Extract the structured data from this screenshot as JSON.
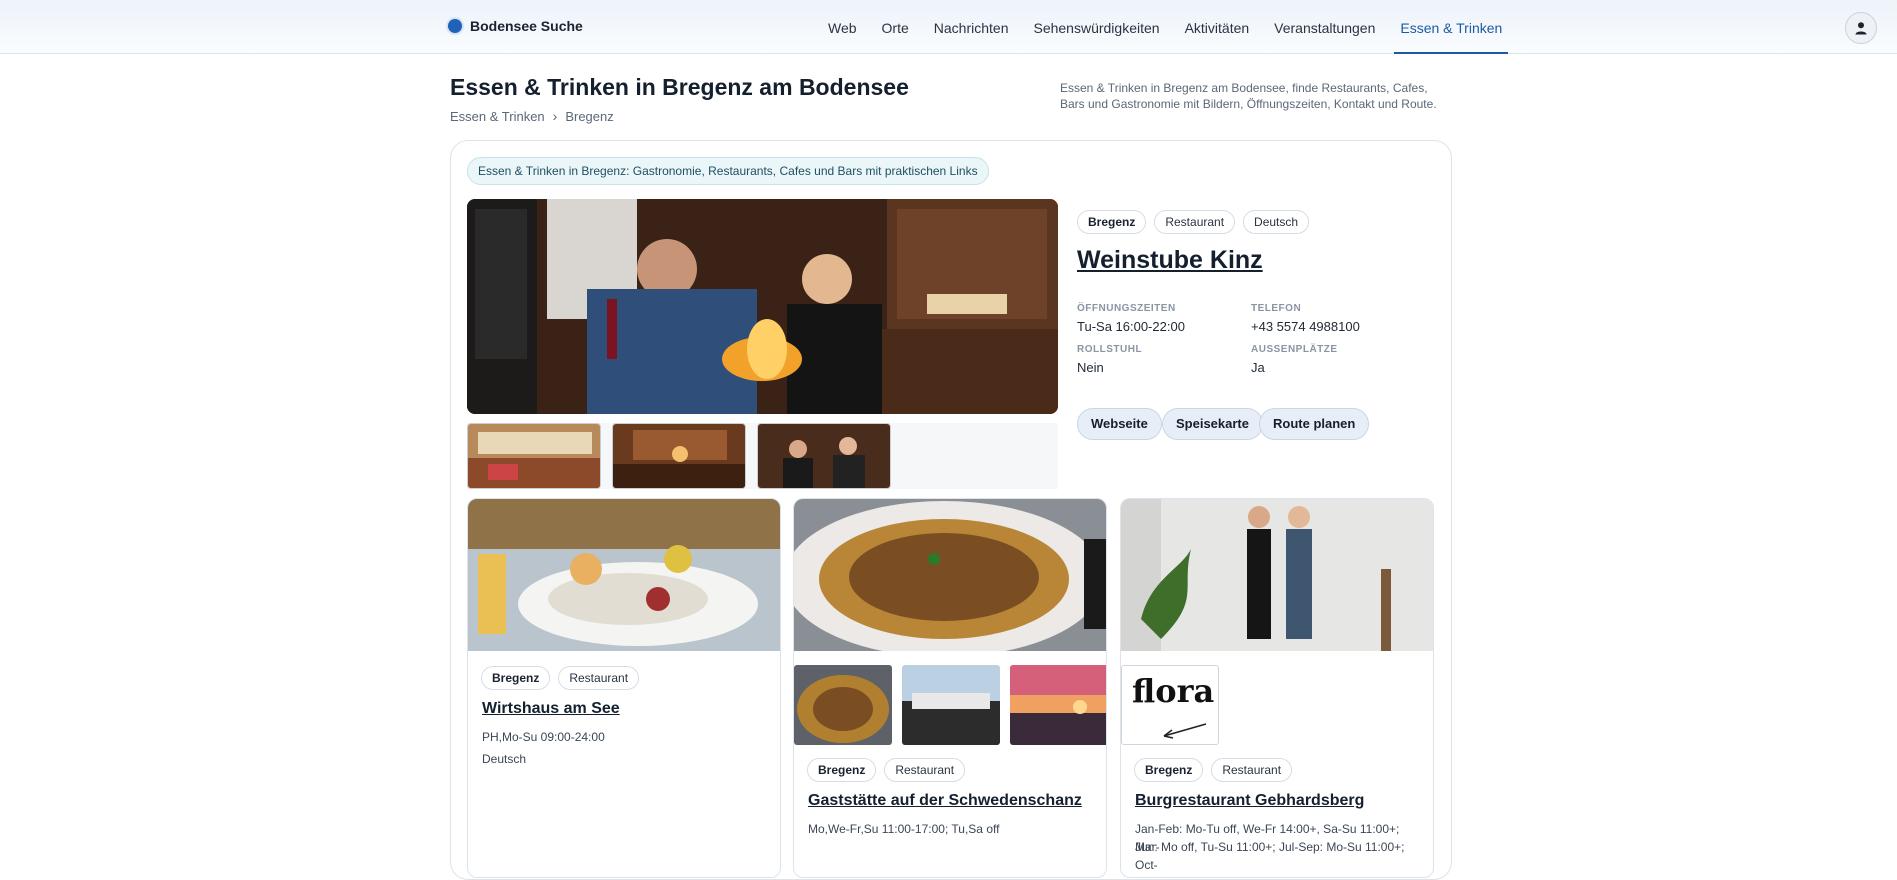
{
  "brand": {
    "name": "Bodensee Suche"
  },
  "nav": {
    "items": [
      "Web",
      "Orte",
      "Nachrichten",
      "Sehenswürdigkeiten",
      "Aktivitäten",
      "Veranstaltungen",
      "Essen & Trinken"
    ],
    "active_index": 6
  },
  "page": {
    "title": "Essen & Trinken in Bregenz am Bodensee",
    "breadcrumb": [
      "Essen & Trinken",
      "Bregenz"
    ],
    "description": "Essen & Trinken in Bregenz am Bodensee, finde Restaurants, Cafes, Bars und Gastronomie mit Bildern, Öffnungszeiten, Kontakt und Route."
  },
  "main": {
    "tag": "Essen & Trinken in Bregenz: Gastronomie, Restaurants, Cafes und Bars mit praktischen Links",
    "featured": {
      "chips": [
        "Bregenz",
        "Restaurant",
        "Deutsch"
      ],
      "title": "Weinstube Kinz",
      "fields": [
        {
          "label": "ÖFFNUNGSZEITEN",
          "value": "Tu-Sa 16:00-22:00"
        },
        {
          "label": "TELEFON",
          "value": "+43 5574 4988100"
        },
        {
          "label": "ROLLSTUHL",
          "value": "Nein"
        },
        {
          "label": "AUSSENPLÄTZE",
          "value": "Ja"
        }
      ],
      "actions": [
        "Webseite",
        "Speisekarte",
        "Route planen"
      ]
    },
    "cards": [
      {
        "chips": [
          "Bregenz",
          "Restaurant"
        ],
        "title": "Wirtshaus am See",
        "lines": [
          "PH,Mo-Su 09:00-24:00",
          "Deutsch"
        ]
      },
      {
        "chips": [
          "Bregenz",
          "Restaurant"
        ],
        "title": "Gaststätte auf der Schwedenschanz",
        "lines": [
          "Mo,We-Fr,Su 11:00-17:00; Tu,Sa off"
        ]
      },
      {
        "chips": [
          "Bregenz",
          "Restaurant"
        ],
        "title": "Burgrestaurant Gebhardsberg",
        "lines": [
          "Jan-Feb: Mo-Tu off, We-Fr 14:00+, Sa-Su 11:00+; Mar-",
          "Jun: Mo off, Tu-Su 11:00+; Jul-Sep: Mo-Su 11:00+; Oct-"
        ]
      }
    ],
    "logo_text": "flora"
  }
}
